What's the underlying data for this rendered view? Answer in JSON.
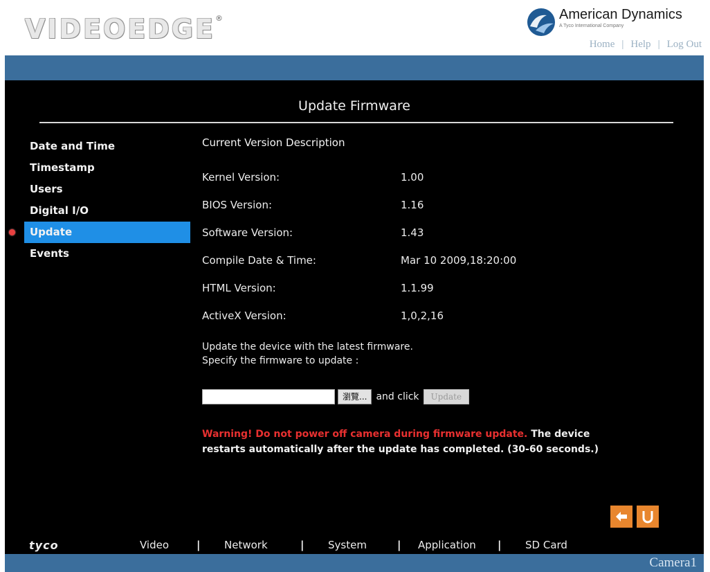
{
  "header": {
    "logo_text": "VIDEOEDGE",
    "brand_name": "American Dynamics",
    "brand_sub": "A Tyco International Company",
    "links": [
      "Home",
      "Help",
      "Log Out"
    ]
  },
  "page": {
    "title": "Update Firmware"
  },
  "sidebar": {
    "items": [
      {
        "label": "Date and Time",
        "active": false
      },
      {
        "label": "Timestamp",
        "active": false
      },
      {
        "label": "Users",
        "active": false
      },
      {
        "label": "Digital I/O",
        "active": false
      },
      {
        "label": "Update",
        "active": true
      },
      {
        "label": "Events",
        "active": false
      }
    ]
  },
  "firmware": {
    "heading": "Current Version Description",
    "rows": [
      {
        "label": "Kernel Version:",
        "value": "1.00"
      },
      {
        "label": "BIOS Version:",
        "value": "1.16"
      },
      {
        "label": "Software Version:",
        "value": "1.43"
      },
      {
        "label": "Compile Date & Time:",
        "value": "Mar 10 2009,18:20:00"
      },
      {
        "label": "HTML Version:",
        "value": "1.1.99"
      },
      {
        "label": "ActiveX Version:",
        "value": "1,0,2,16"
      }
    ]
  },
  "update": {
    "instruction_1": "Update the device with the latest firmware.",
    "instruction_2": "Specify the firmware to update :",
    "file_value": "",
    "browse_label": "瀏覽...",
    "and_click": "and click",
    "update_label": "Update",
    "warning_red": "Warning! Do not power off camera during firmware update.",
    "warning_rest": " The device restarts automatically after the update has completed. (30-60 seconds.)"
  },
  "bottom_nav": {
    "brand": "tyco",
    "items": [
      "Video",
      "Network",
      "System",
      "Application",
      "SD Card"
    ]
  },
  "status": {
    "camera": "Camera1"
  },
  "colors": {
    "bar_blue": "#3b6e9c",
    "active_blue": "#1f8fe6",
    "warning_red": "#e83030",
    "action_orange": "#e8862e"
  }
}
